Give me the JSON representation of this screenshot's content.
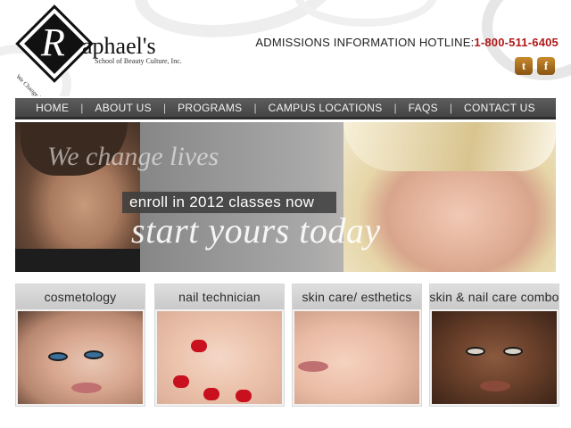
{
  "header": {
    "logo": {
      "initial": "R",
      "name": "aphael's",
      "subtitle": "School of Beauty Culture, Inc.",
      "motto": "We Change Lives"
    },
    "hotline_label": "ADMISSIONS INFORMATION HOTLINE:",
    "hotline_number": "1-800-511-6405",
    "social": [
      {
        "name": "twitter-icon",
        "glyph": "t"
      },
      {
        "name": "facebook-icon",
        "glyph": "f"
      }
    ]
  },
  "nav": {
    "items": [
      "HOME",
      "ABOUT US",
      "PROGRAMS",
      "CAMPUS LOCATIONS",
      "FAQS",
      "CONTACT US"
    ]
  },
  "hero": {
    "tagline": "We change lives",
    "enroll": "enroll in 2012 classes now",
    "cta": "start yours today"
  },
  "programs": [
    {
      "title": "cosmetology"
    },
    {
      "title": "nail technician"
    },
    {
      "title": "skin care/ esthetics"
    },
    {
      "title": "skin & nail care combo"
    }
  ],
  "colors": {
    "nav_bg": "#4f4f4f",
    "phone": "#b01818",
    "social_icon": "#b5741f"
  }
}
